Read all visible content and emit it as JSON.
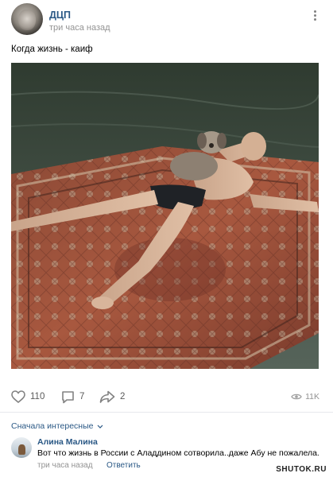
{
  "post": {
    "author": "ДЦП",
    "time": "три часа назад",
    "text": "Когда жизнь - каиф"
  },
  "actions": {
    "likes": "110",
    "comments": "7",
    "shares": "2",
    "views": "11K"
  },
  "comments_section": {
    "sort_label": "Сначала интересные",
    "items": [
      {
        "author": "Алина Малина",
        "text": "Вот что жизнь в России с Аладдином сотворила..даже Абу не пожалела.",
        "time": "три часа назад",
        "reply_label": "Ответить"
      }
    ]
  },
  "watermark": "SHUTOK.RU",
  "icons": {
    "like": "heart-icon",
    "comment": "comment-icon",
    "share": "share-icon",
    "views": "eye-icon",
    "more": "more-icon",
    "sort": "chevron-down-icon"
  },
  "colors": {
    "link": "#2a5885",
    "muted": "#939393",
    "icon": "#828282"
  }
}
